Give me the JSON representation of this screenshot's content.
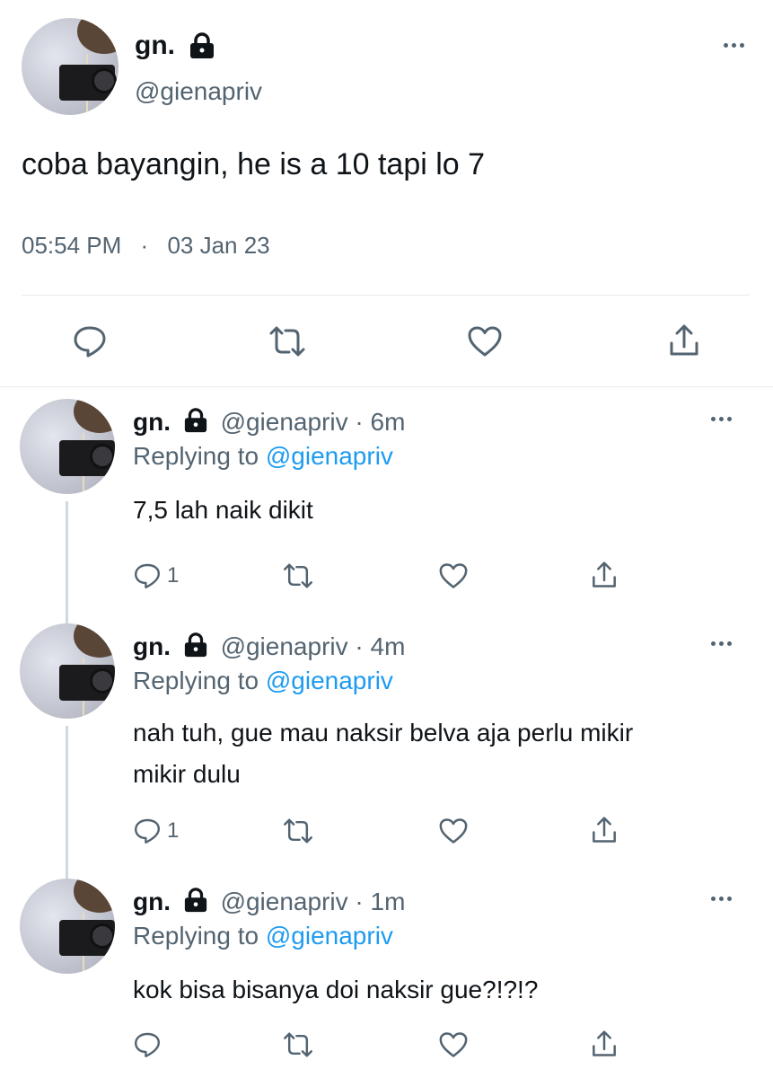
{
  "main_tweet": {
    "name": "gn.",
    "handle": "@gienapriv",
    "text": "coba bayangin, he is a 10 tapi lo 7",
    "time": "05:54 PM",
    "separator": "·",
    "date": "03 Jan 23"
  },
  "replies": [
    {
      "name": "gn.",
      "handle": "@gienapriv",
      "dot": "·",
      "age": "6m",
      "replying_prefix": "Replying to",
      "replying_handle": "@gienapriv",
      "text_lines": [
        "7,5 lah naik dikit"
      ],
      "reply_count": "1"
    },
    {
      "name": "gn.",
      "handle": "@gienapriv",
      "dot": "·",
      "age": "4m",
      "replying_prefix": "Replying to",
      "replying_handle": "@gienapriv",
      "text_lines": [
        "nah tuh, gue mau naksir belva aja perlu mikir",
        "mikir dulu"
      ],
      "reply_count": "1"
    },
    {
      "name": "gn.",
      "handle": "@gienapriv",
      "dot": "·",
      "age": "1m",
      "replying_prefix": "Replying to",
      "replying_handle": "@gienapriv",
      "text_lines": [
        "kok bisa bisanya doi naksir gue?!?!?"
      ],
      "reply_count": ""
    }
  ],
  "colors": {
    "text": "#0f1419",
    "secondary": "#536471",
    "link": "#1d9bf0",
    "divider": "#e6ecf0"
  },
  "icons": [
    "lock-icon",
    "more-icon",
    "reply-icon",
    "retweet-icon",
    "like-icon",
    "share-icon"
  ]
}
